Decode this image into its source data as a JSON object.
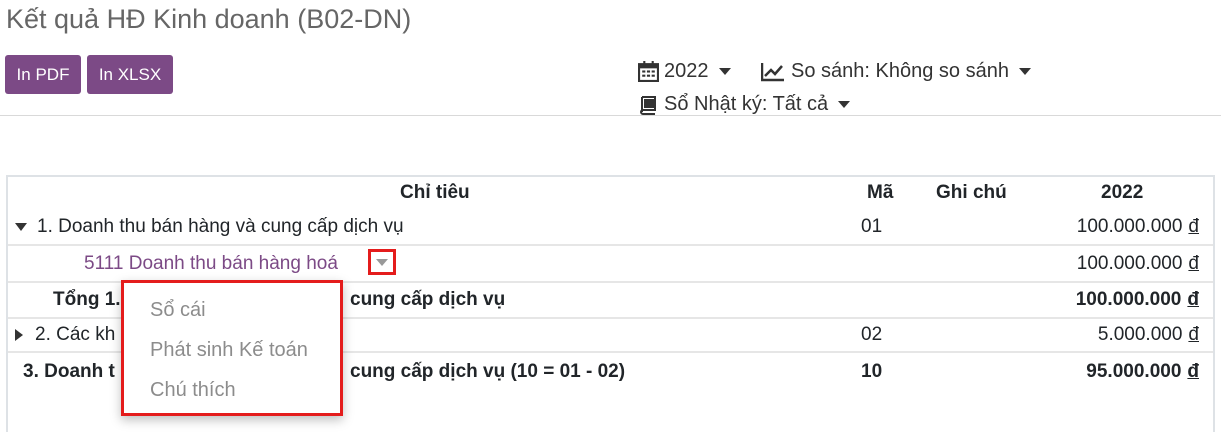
{
  "page": {
    "title": "Kết quả HĐ Kinh doanh (B02-DN)"
  },
  "toolbar": {
    "pdf_label": "In PDF",
    "xlsx_label": "In XLSX"
  },
  "filters": {
    "year": "2022",
    "compare": "So sánh: Không so sánh",
    "journal": "Sổ Nhật ký: Tất cả"
  },
  "table": {
    "headers": {
      "indicator": "Chỉ tiêu",
      "code": "Mã",
      "note": "Ghi chú",
      "year": "2022"
    },
    "currency": "đ",
    "rows": [
      {
        "label": "1. Doanh thu bán hàng và cung cấp dịch vụ",
        "code": "01",
        "value": "100.000.000"
      },
      {
        "label": "5111 Doanh thu bán hàng hoá",
        "code": "",
        "value": "100.000.000"
      },
      {
        "label": "Tổng 1.",
        "label_tail": "cung cấp dịch vụ",
        "code": "",
        "value": "100.000.000"
      },
      {
        "label": "2. Các kh",
        "code": "02",
        "value": "5.000.000"
      },
      {
        "label": "3. Doanh t",
        "label_tail": "cung cấp dịch vụ (10 = 01 - 02)",
        "code": "10",
        "value": "95.000.000"
      }
    ]
  },
  "context_menu": {
    "items": [
      "Sổ cái",
      "Phát sinh Kế toán",
      "Chú thích"
    ]
  },
  "colors": {
    "primary": "#7c4a86",
    "highlight": "#e41c1c"
  }
}
